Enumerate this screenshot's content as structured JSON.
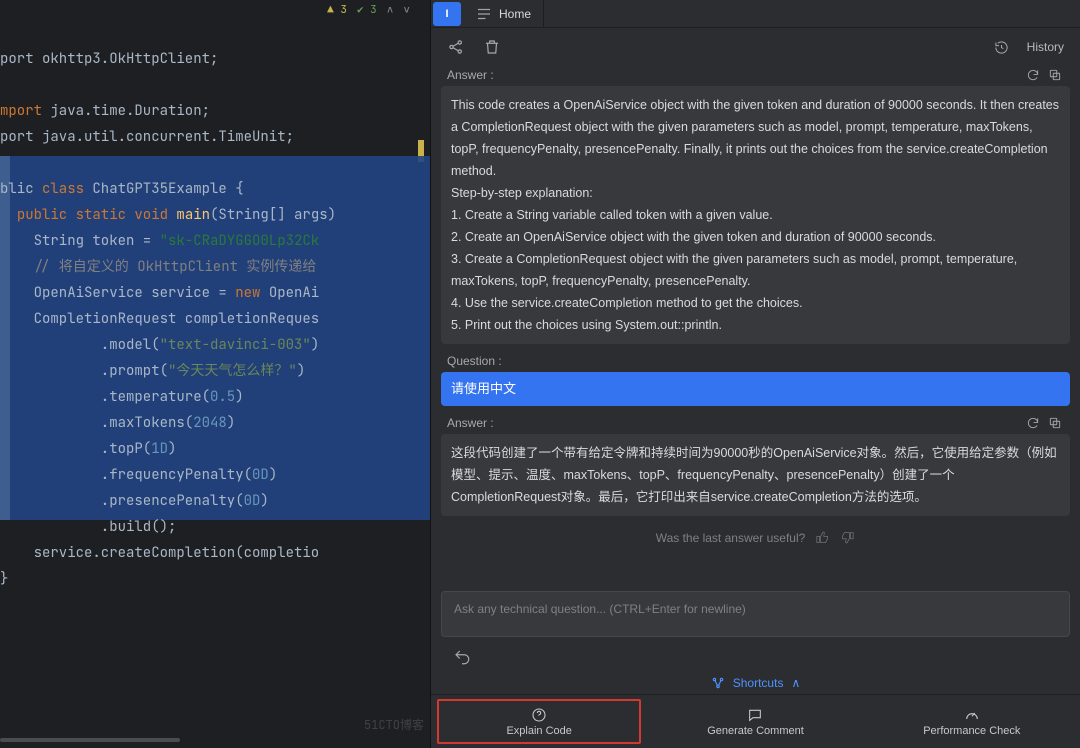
{
  "editor": {
    "inspections": {
      "warnings": "3",
      "passes": "3"
    },
    "lines": {
      "l1a": "port ",
      "l1b": "okhttp3.OkHttpClient",
      "l1c": ";",
      "imp": "mport ",
      "l3": "java.time.Duration",
      "l3b": ";",
      "l4a": "port ",
      "l4": "java.util.concurrent.TimeUnit",
      "l4b": ";",
      "cls_a": "blic ",
      "cls_k": "class ",
      "cls": "ChatGPT35Example ",
      "cls_b": "{",
      "main_a": "  ",
      "main_k": "public static void ",
      "main_f": "main",
      "main_p": "(String[] args)",
      "tok_a": "    String token = ",
      "tok_s": "\"sk-CRaDYGGO0Lp32Ck",
      "cmt": "    // 将自定义的 OkHttpClient 实例传递给",
      "svc_a": "    OpenAiService service = ",
      "svc_k": "new ",
      "svc_b": "OpenAi",
      "req": "    CompletionRequest completionReques",
      "model_a": "            .model(",
      "model_s": "\"text-davinci-003\"",
      "model_b": ")",
      "prompt_a": "            .prompt(",
      "prompt_s": "\"今天天气怎么样？\"",
      "prompt_b": ")",
      "temp_a": "            .temperature(",
      "temp_n": "0.5",
      "temp_b": ")",
      "max_a": "            .maxTokens(",
      "max_n": "2048",
      "max_b": ")",
      "topp_a": "            .topP(",
      "topp_n": "1D",
      "topp_b": ")",
      "freq_a": "            .frequencyPenalty(",
      "freq_n": "0D",
      "freq_b": ")",
      "pres_a": "            .presencePenalty(",
      "pres_n": "0D",
      "pres_b": ")",
      "build": "            .build();",
      "call": "    service.createCompletion(completio",
      "end": "}"
    },
    "watermark": "51CTO博客"
  },
  "tabs": {
    "badge": "I",
    "home": "Home"
  },
  "toolbar": {
    "history": "History"
  },
  "conversation": {
    "answer_label": "Answer :",
    "question_label": "Question :",
    "answer1_p1": "This code creates a OpenAiService object with the given token and duration of 90000 seconds. It then creates a CompletionRequest object with the given parameters such as model, prompt, temperature, maxTokens, topP, frequencyPenalty, presencePenalty. Finally, it prints out the choices from the service.createCompletion method.",
    "answer1_p2": " Step-by-step explanation:",
    "answer1_s1": "1. Create a String variable called token with a given value.",
    "answer1_s2": "2. Create an OpenAiService object with the given token and duration of 90000 seconds.",
    "answer1_s3": "3. Create a CompletionRequest object with the given parameters such as model, prompt, temperature, maxTokens, topP, frequencyPenalty, presencePenalty.",
    "answer1_s4": "4. Use the service.createCompletion method to get the choices.",
    "answer1_s5": "5. Print out the choices using System.out::println.",
    "question1": "请使用中文",
    "answer2": "这段代码创建了一个带有给定令牌和持续时间为90000秒的OpenAiService对象。然后，它使用给定参数（例如模型、提示、温度、maxTokens、topP、frequencyPenalty、presencePenalty）创建了一个CompletionRequest对象。最后，它打印出来自service.createCompletion方法的选项。",
    "feedback": "Was the last answer useful?"
  },
  "ask": {
    "placeholder": "Ask any technical question... (CTRL+Enter for newline)"
  },
  "shortcuts": {
    "label": "Shortcuts"
  },
  "actions": {
    "explain": "Explain Code",
    "comment": "Generate Comment",
    "perf": "Performance Check"
  }
}
